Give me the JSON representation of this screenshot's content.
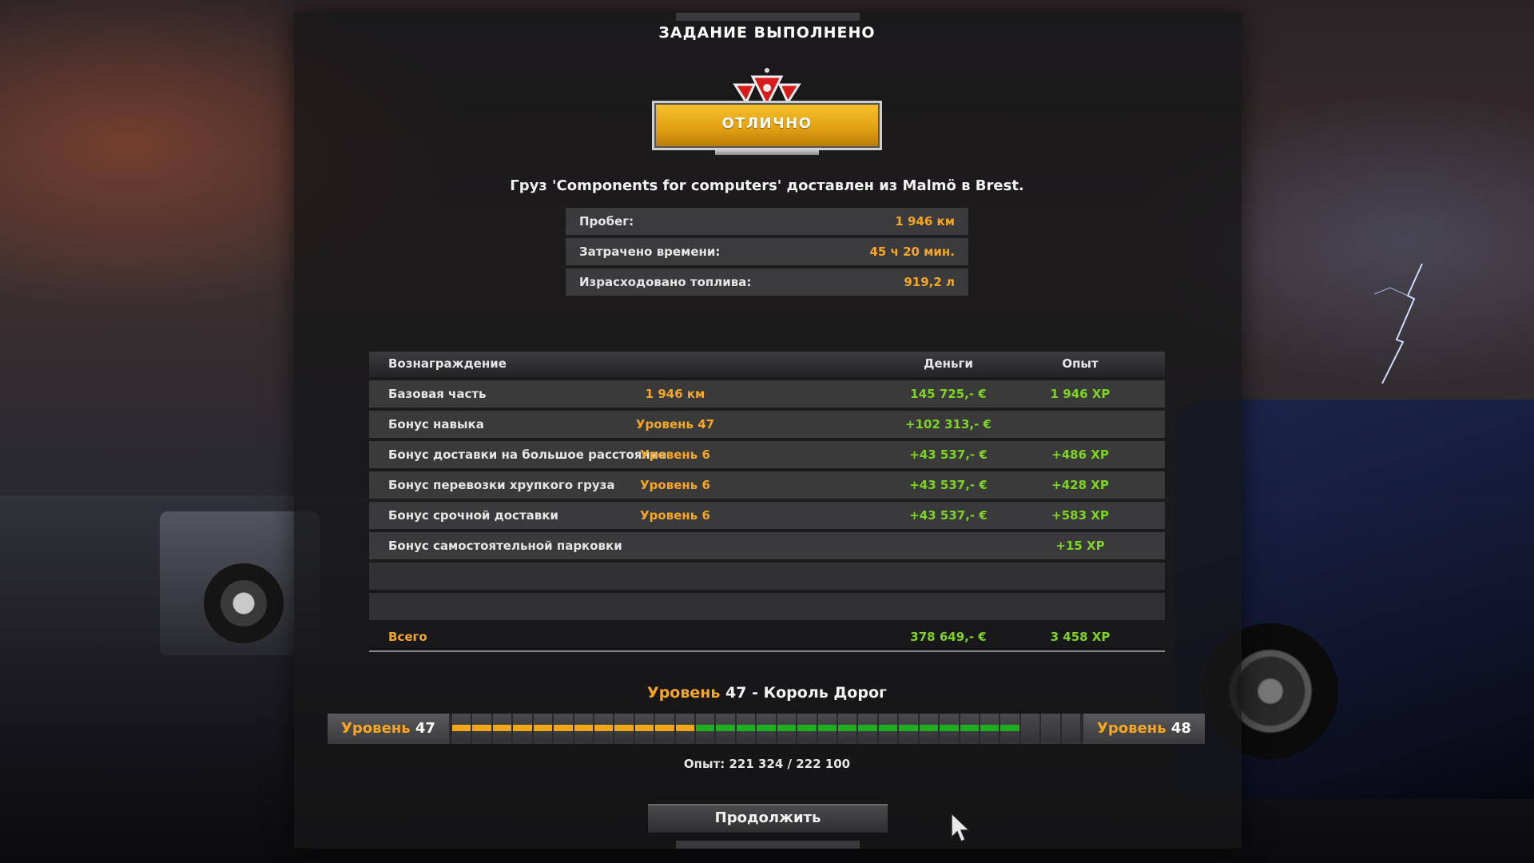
{
  "header": {
    "title": "ЗАДАНИЕ ВЫПОЛНЕНО"
  },
  "rating": {
    "label": "ОТЛИЧНО",
    "accent": "#e4a212"
  },
  "delivery": {
    "message": "Груз 'Components for computers' доставлен из Malmö в Brest."
  },
  "stats": [
    {
      "label": "Пробег:",
      "value": "1 946 км"
    },
    {
      "label": "Затрачено времени:",
      "value": "45 ч 20 мин."
    },
    {
      "label": "Израсходовано топлива:",
      "value": "919,2 л"
    }
  ],
  "rewards": {
    "headers": {
      "name": "Вознаграждение",
      "money": "Деньги",
      "xp": "Опыт"
    },
    "rows": [
      {
        "name": "Базовая часть",
        "detail": "1 946 км",
        "money": "145 725,- €",
        "xp": "1 946 XP"
      },
      {
        "name": "Бонус навыка",
        "detail": "Уровень 47",
        "money": "+102 313,- €",
        "xp": ""
      },
      {
        "name": "Бонус доставки на большое расстояние",
        "detail": "Уровень 6",
        "money": "+43 537,- €",
        "xp": "+486 XP"
      },
      {
        "name": "Бонус перевозки хрупкого груза",
        "detail": "Уровень 6",
        "money": "+43 537,- €",
        "xp": "+428 XP"
      },
      {
        "name": "Бонус срочной доставки",
        "detail": "Уровень 6",
        "money": "+43 537,- €",
        "xp": "+583 XP"
      },
      {
        "name": "Бонус самостоятельной парковки",
        "detail": "",
        "money": "",
        "xp": "+15 XP"
      },
      {
        "name": "",
        "detail": "",
        "money": "",
        "xp": ""
      },
      {
        "name": "",
        "detail": "",
        "money": "",
        "xp": ""
      }
    ],
    "total": {
      "name": "Всего",
      "money": "378 649,- €",
      "xp": "3 458 XP"
    }
  },
  "level": {
    "title_word": "Уровень",
    "title_rest": "47 - Король Дорог",
    "current_word": "Уровень",
    "current_num": "47",
    "next_word": "Уровень",
    "next_num": "48",
    "progress": {
      "segments": 31,
      "old_filled": 12,
      "new_filled": 16
    },
    "xp_text": "Опыт: 221 324 / 222 100",
    "colors": {
      "old": "#f0a81a",
      "new": "#1fae1f"
    }
  },
  "actions": {
    "continue_label": "Продолжить"
  },
  "icons": {
    "emblem": "rank-emblem-icon",
    "cursor": "mouse-cursor-icon"
  }
}
